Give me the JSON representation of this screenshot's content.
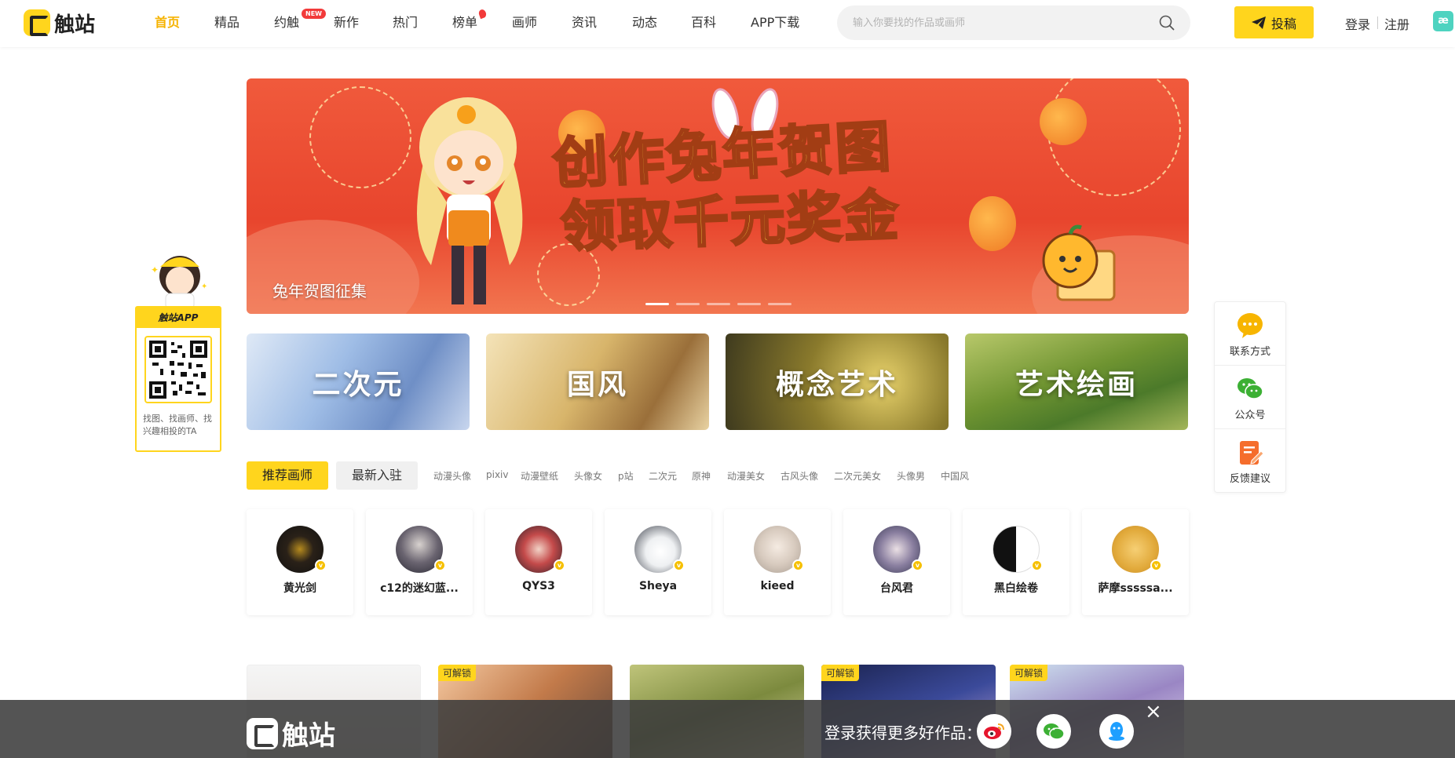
{
  "header": {
    "logo_text": "触站",
    "nav": [
      {
        "label": "首页",
        "active": true
      },
      {
        "label": "精品"
      },
      {
        "label": "约触"
      },
      {
        "label": "新作"
      },
      {
        "label": "热门"
      },
      {
        "label": "榜单"
      },
      {
        "label": "画师"
      },
      {
        "label": "资讯"
      },
      {
        "label": "动态"
      },
      {
        "label": "百科"
      },
      {
        "label": "APP下载"
      }
    ],
    "badge_new": "NEW",
    "search_placeholder": "输入你要找的作品或画师",
    "post_label": "投稿",
    "login_label": "登录",
    "register_label": "注册",
    "ae_icon": "æ"
  },
  "banner": {
    "headline_line1": "创作兔年贺图",
    "headline_line2": "领取千元奖金",
    "caption": "兔年贺图征集",
    "colors": {
      "bg": "#e8452d",
      "headline": "#ffe14a"
    }
  },
  "categories": [
    {
      "label": "二次元"
    },
    {
      "label": "国风"
    },
    {
      "label": "概念艺术"
    },
    {
      "label": "艺术绘画"
    }
  ],
  "artist_tabs": {
    "active": "推荐画师",
    "other": "最新入驻",
    "tags": [
      "动漫头像",
      "pixiv",
      "动漫壁纸",
      "头像女",
      "p站",
      "二次元",
      "原神",
      "动漫美女",
      "古风头像",
      "二次元美女",
      "头像男",
      "中国风"
    ]
  },
  "artists": [
    {
      "name": "黄光剑"
    },
    {
      "name": "c12的迷幻蓝..."
    },
    {
      "name": "QYS3"
    },
    {
      "name": "Sheya"
    },
    {
      "name": "kieed"
    },
    {
      "name": "台风君"
    },
    {
      "name": "黑白绘卷"
    },
    {
      "name": "萨摩sssssa..."
    }
  ],
  "works": {
    "unlock_label": "可解锁"
  },
  "bottom_bar": {
    "logo_text": "触站",
    "prompt": "登录获得更多好作品：",
    "socials": [
      "weibo-icon",
      "wechat-icon",
      "qq-icon"
    ],
    "close": "×"
  },
  "side_app": {
    "title": "触站APP",
    "desc": "找图、找画师、找兴趣相投的TA"
  },
  "right_panel": [
    {
      "label": "联系方式",
      "icon": "chat-bubble-icon"
    },
    {
      "label": "公众号",
      "icon": "wechat-icon"
    },
    {
      "label": "反馈建议",
      "icon": "feedback-icon"
    }
  ]
}
